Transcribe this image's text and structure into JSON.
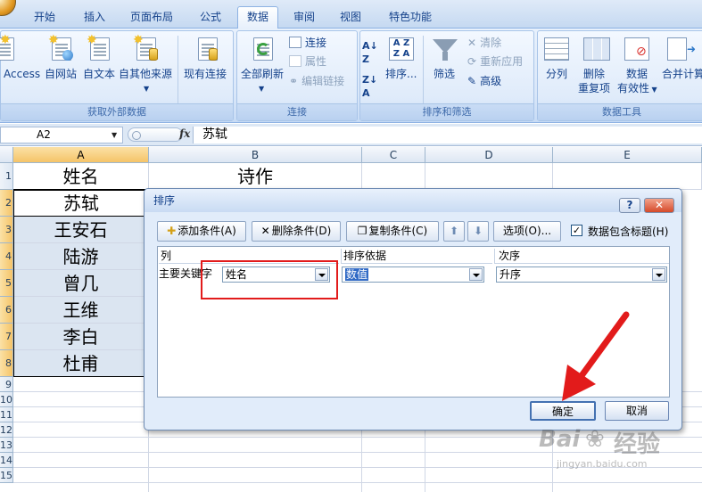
{
  "ribbon": {
    "tabs": [
      "开始",
      "插入",
      "页面布局",
      "公式",
      "数据",
      "审阅",
      "视图",
      "特色功能"
    ],
    "active_tab": "数据",
    "groups": {
      "external": {
        "label": "获取外部数据",
        "buttons": [
          "Access",
          "自网站",
          "自文本",
          "自其他来源",
          "现有连接"
        ]
      },
      "connections": {
        "label": "连接",
        "refresh_all": "全部刷新",
        "connect": "连接",
        "properties": "属性",
        "edit_links": "编辑链接"
      },
      "sortfilter": {
        "label": "排序和筛选",
        "sort": "排序...",
        "filter": "筛选",
        "clear": "清除",
        "reapply": "重新应用",
        "advanced": "高级"
      },
      "datatools": {
        "label": "数据工具",
        "split": "分列",
        "remove_dup_1": "删除",
        "remove_dup_2": "重复项",
        "validation_1": "数据",
        "validation_2": "有效性",
        "consolidate": "合并计算"
      }
    }
  },
  "formula_bar": {
    "name_box": "A2",
    "fx": "fx",
    "value": "苏轼"
  },
  "grid": {
    "columns": [
      "A",
      "B",
      "C",
      "D",
      "E"
    ],
    "header_row": [
      "姓名",
      "诗作"
    ],
    "names": [
      "苏轼",
      "王安石",
      "陆游",
      "曾几",
      "王维",
      "李白",
      "杜甫"
    ],
    "row_numbers": [
      "1",
      "2",
      "3",
      "4",
      "5",
      "6",
      "7",
      "8",
      "9",
      "10",
      "11",
      "12",
      "13",
      "14",
      "15"
    ]
  },
  "dialog": {
    "title": "排序",
    "help": "?",
    "close": "✕",
    "add_level": "添加条件(A)",
    "delete_level": "删除条件(D)",
    "copy_level": "复制条件(C)",
    "options": "选项(O)...",
    "has_headers": "数据包含标题(H)",
    "has_headers_checked": true,
    "col_header": "列",
    "sort_on_header": "排序依据",
    "order_header": "次序",
    "row_label": "主要关键字",
    "column_value": "姓名",
    "sort_on_value": "数值",
    "order_value": "升序",
    "ok": "确定",
    "cancel": "取消"
  },
  "watermark": {
    "line1": "Bai",
    "line2": "经验",
    "line3": "jingyan.baidu.com"
  },
  "colors": {
    "annotation_red": "#e21b1b",
    "selection_blue": "#316ac5",
    "highlight_cell": "#dbe5f1"
  }
}
